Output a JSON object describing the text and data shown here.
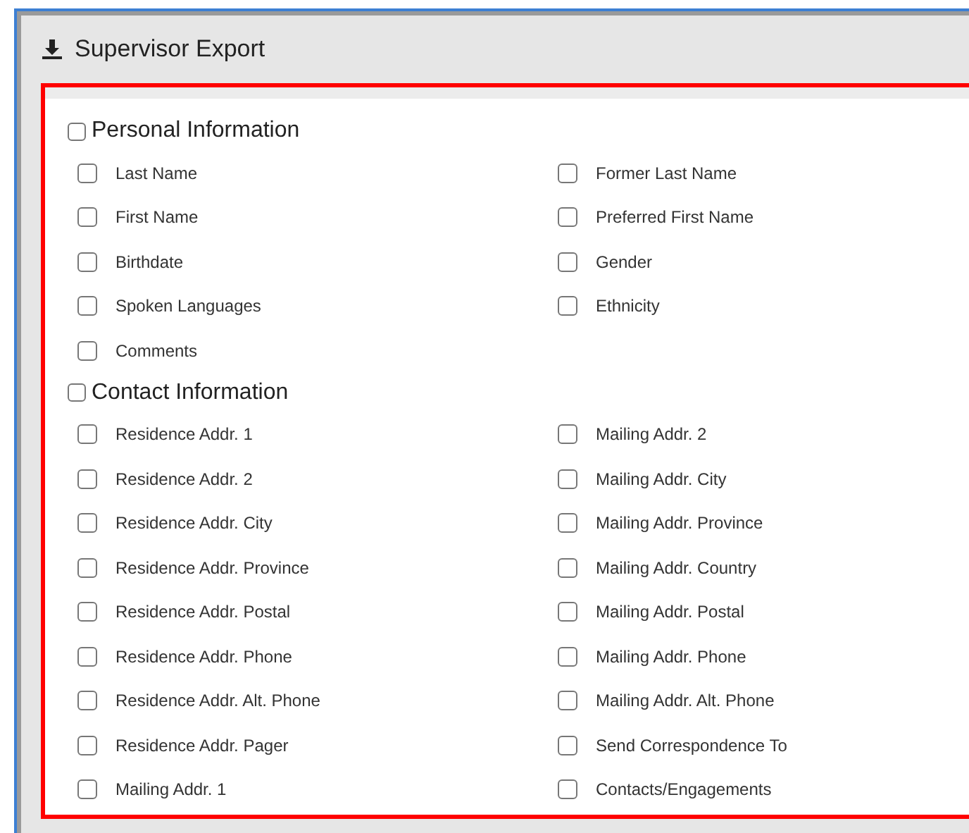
{
  "window": {
    "title": "Supervisor Export"
  },
  "sections": [
    {
      "label": "Personal Information",
      "checked": false,
      "columns": [
        [
          {
            "label": "Last Name",
            "checked": false
          },
          {
            "label": "First Name",
            "checked": false
          },
          {
            "label": "Birthdate",
            "checked": false
          },
          {
            "label": "Spoken Languages",
            "checked": false
          },
          {
            "label": "Comments",
            "checked": false
          }
        ],
        [
          {
            "label": "Former Last Name",
            "checked": false
          },
          {
            "label": "Preferred First Name",
            "checked": false
          },
          {
            "label": "Gender",
            "checked": false
          },
          {
            "label": "Ethnicity",
            "checked": false
          }
        ]
      ]
    },
    {
      "label": "Contact Information",
      "checked": false,
      "columns": [
        [
          {
            "label": "Residence Addr. 1",
            "checked": false
          },
          {
            "label": "Residence Addr. 2",
            "checked": false
          },
          {
            "label": "Residence Addr. City",
            "checked": false
          },
          {
            "label": "Residence Addr. Province",
            "checked": false
          },
          {
            "label": "Residence Addr. Postal",
            "checked": false
          },
          {
            "label": "Residence Addr. Phone",
            "checked": false
          },
          {
            "label": "Residence Addr. Alt. Phone",
            "checked": false
          },
          {
            "label": "Residence Addr. Pager",
            "checked": false
          },
          {
            "label": "Mailing Addr. 1",
            "checked": false
          }
        ],
        [
          {
            "label": "Mailing Addr. 2",
            "checked": false
          },
          {
            "label": "Mailing Addr. City",
            "checked": false
          },
          {
            "label": "Mailing Addr. Province",
            "checked": false
          },
          {
            "label": "Mailing Addr. Country",
            "checked": false
          },
          {
            "label": "Mailing Addr. Postal",
            "checked": false
          },
          {
            "label": "Mailing Addr. Phone",
            "checked": false
          },
          {
            "label": "Mailing Addr. Alt. Phone",
            "checked": false
          },
          {
            "label": "Send Correspondence To",
            "checked": false
          },
          {
            "label": "Contacts/Engagements",
            "checked": false
          }
        ]
      ]
    }
  ]
}
